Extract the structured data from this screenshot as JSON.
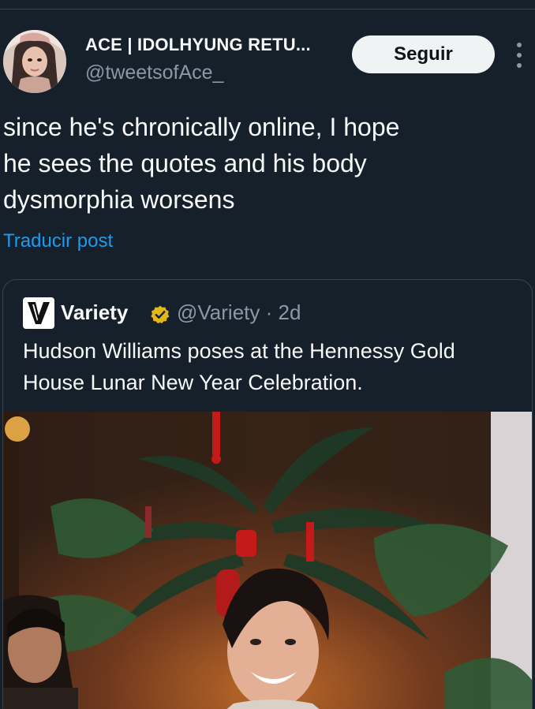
{
  "post": {
    "author": {
      "display_name": "ACE | IDOLHYUNG RETU...",
      "handle": "@tweetsofAce_"
    },
    "follow_label": "Seguir",
    "more_icon": "more-vertical-icon",
    "text": "since he's chronically online, I hope\nhe sees the quotes and his body\ndysmorphia worsens",
    "translate_label": "Traducir post"
  },
  "quoted_post": {
    "author": {
      "display_name": "Variety",
      "verified": true,
      "verified_color": "#e2b719",
      "handle_time": "@Variety · 2d"
    },
    "text": "Hudson Williams poses at the Hennessy Gold House Lunar New Year Celebration.",
    "media": "photo"
  },
  "colors": {
    "background": "#15202b",
    "text_primary": "#f7f9f9",
    "text_secondary": "#8b98a5",
    "link": "#1d9bf0",
    "border": "#38444d",
    "follow_bg": "#eff3f4"
  }
}
